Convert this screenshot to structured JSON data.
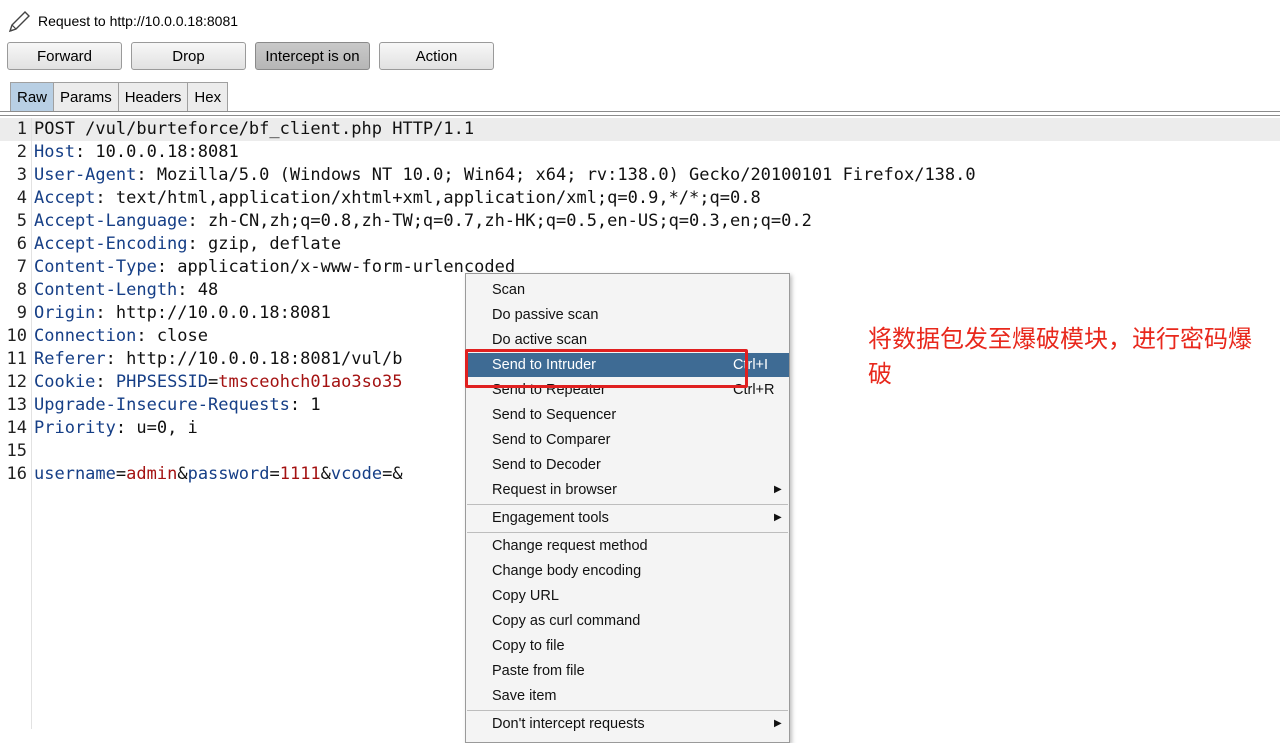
{
  "window": {
    "title": "Request to http://10.0.0.18:8081"
  },
  "toolbar": {
    "forward": "Forward",
    "drop": "Drop",
    "intercept": "Intercept is on",
    "action": "Action"
  },
  "tabs": [
    "Raw",
    "Params",
    "Headers",
    "Hex"
  ],
  "request_lines": [
    {
      "n": "1",
      "parts": [
        [
          "plain",
          "POST /vul/burteforce/bf_client.php HTTP/1.1"
        ]
      ]
    },
    {
      "n": "2",
      "parts": [
        [
          "hn",
          "Host"
        ],
        [
          "plain",
          ": 10.0.0.18:8081"
        ]
      ]
    },
    {
      "n": "3",
      "parts": [
        [
          "hn",
          "User-Agent"
        ],
        [
          "plain",
          ": Mozilla/5.0 (Windows NT 10.0; Win64; x64; rv:138.0) Gecko/20100101 Firefox/138.0"
        ]
      ]
    },
    {
      "n": "4",
      "parts": [
        [
          "hn",
          "Accept"
        ],
        [
          "plain",
          ": text/html,application/xhtml+xml,application/xml;q=0.9,*/*;q=0.8"
        ]
      ]
    },
    {
      "n": "5",
      "parts": [
        [
          "hn",
          "Accept-Language"
        ],
        [
          "plain",
          ": zh-CN,zh;q=0.8,zh-TW;q=0.7,zh-HK;q=0.5,en-US;q=0.3,en;q=0.2"
        ]
      ]
    },
    {
      "n": "6",
      "parts": [
        [
          "hn",
          "Accept-Encoding"
        ],
        [
          "plain",
          ": gzip, deflate"
        ]
      ]
    },
    {
      "n": "7",
      "parts": [
        [
          "hn",
          "Content-Type"
        ],
        [
          "plain",
          ": application/x-www-form-urlencoded"
        ]
      ]
    },
    {
      "n": "8",
      "parts": [
        [
          "hn",
          "Content-Length"
        ],
        [
          "plain",
          ": 48"
        ]
      ]
    },
    {
      "n": "9",
      "parts": [
        [
          "hn",
          "Origin"
        ],
        [
          "plain",
          ": http://10.0.0.18:8081"
        ]
      ]
    },
    {
      "n": "10",
      "parts": [
        [
          "hn",
          "Connection"
        ],
        [
          "plain",
          ": close"
        ]
      ]
    },
    {
      "n": "11",
      "parts": [
        [
          "hn",
          "Referer"
        ],
        [
          "plain",
          ": http://10.0.0.18:8081/vul/b"
        ]
      ]
    },
    {
      "n": "12",
      "parts": [
        [
          "hn",
          "Cookie"
        ],
        [
          "plain",
          ": "
        ],
        [
          "hn",
          "PHPSESSID"
        ],
        [
          "plain",
          "="
        ],
        [
          "pv",
          "tmsceohch01ao3so35"
        ]
      ]
    },
    {
      "n": "13",
      "parts": [
        [
          "hn",
          "Upgrade-Insecure-Requests"
        ],
        [
          "plain",
          ": 1"
        ]
      ]
    },
    {
      "n": "14",
      "parts": [
        [
          "hn",
          "Priority"
        ],
        [
          "plain",
          ": u=0, i"
        ]
      ]
    },
    {
      "n": "15",
      "parts": [
        [
          "plain",
          ""
        ]
      ]
    },
    {
      "n": "16",
      "parts": [
        [
          "hn",
          "username"
        ],
        [
          "plain",
          "="
        ],
        [
          "pv",
          "admin"
        ],
        [
          "plain",
          "&"
        ],
        [
          "hn",
          "password"
        ],
        [
          "plain",
          "="
        ],
        [
          "pv",
          "1111"
        ],
        [
          "plain",
          "&"
        ],
        [
          "hn",
          "vcode"
        ],
        [
          "plain",
          "=&"
        ]
      ]
    }
  ],
  "context_menu": {
    "groups": [
      [
        {
          "label": "Scan"
        },
        {
          "label": "Do passive scan"
        },
        {
          "label": "Do active scan"
        },
        {
          "label": "Send to Intruder",
          "shortcut": "Ctrl+I",
          "highlighted": true
        },
        {
          "label": "Send to Repeater",
          "shortcut": "Ctrl+R"
        },
        {
          "label": "Send to Sequencer"
        },
        {
          "label": "Send to Comparer"
        },
        {
          "label": "Send to Decoder"
        },
        {
          "label": "Request in browser",
          "submenu": true
        }
      ],
      [
        {
          "label": "Engagement tools",
          "submenu": true
        }
      ],
      [
        {
          "label": "Change request method"
        },
        {
          "label": "Change body encoding"
        },
        {
          "label": "Copy URL"
        },
        {
          "label": "Copy as curl command"
        },
        {
          "label": "Copy to file"
        },
        {
          "label": "Paste from file"
        },
        {
          "label": "Save item"
        }
      ],
      [
        {
          "label": "Don't intercept requests",
          "submenu": true
        }
      ]
    ]
  },
  "annotation": {
    "text": "将数据包发至爆破模块，进行密码爆破",
    "color": "#e8281c",
    "highlight_color": "#e02020"
  },
  "colors": {
    "menu_highlight": "#3e6b94",
    "tab_selected": "#b8cfe4",
    "header_name": "#153e86",
    "param_value": "#a41212"
  }
}
